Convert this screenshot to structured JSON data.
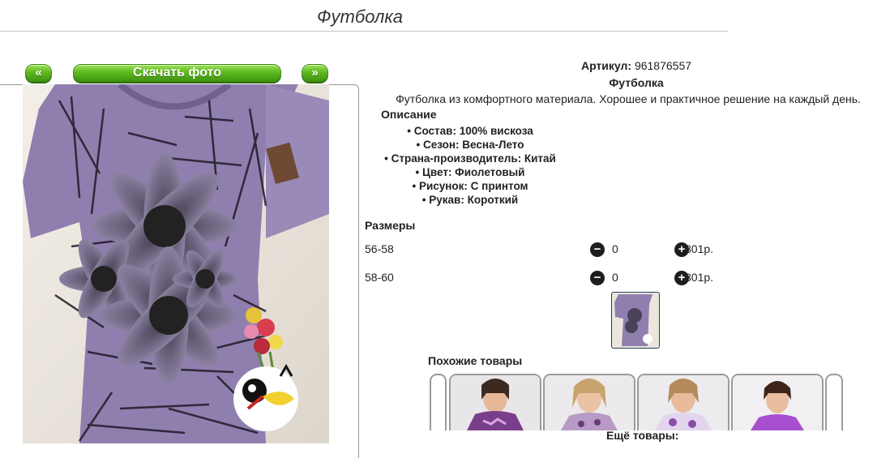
{
  "page": {
    "title": "Футболка"
  },
  "gallery": {
    "prev_label": "«",
    "next_label": "»",
    "download_label": "Скачать фото"
  },
  "product": {
    "sku_label": "Артикул:",
    "sku_value": "961876557",
    "name": "Футболка",
    "description": "Футболка из комфортного материала. Хорошее и практичное решение на каждый день.",
    "description_heading": "Описание",
    "specs": [
      "Состав: 100% вискоза",
      "Сезон: Весна-Лето",
      "Страна-производитель: Китай",
      "Цвет: Фиолетовый",
      "Рисунок: С принтом",
      "Рукав: Короткий"
    ]
  },
  "sizes": {
    "heading": "Размеры",
    "rows": [
      {
        "size": "56-58",
        "qty": "0",
        "price": "801р."
      },
      {
        "size": "58-60",
        "qty": "0",
        "price": "801р."
      }
    ],
    "minus_symbol": "−",
    "plus_symbol": "+"
  },
  "similar": {
    "heading": "Похожие товары",
    "more_label": "Ещё товары:"
  },
  "colors": {
    "accent_green": "#5fba1f",
    "shirt_purple": "#8a78a8",
    "print_black": "#1e1a26"
  }
}
